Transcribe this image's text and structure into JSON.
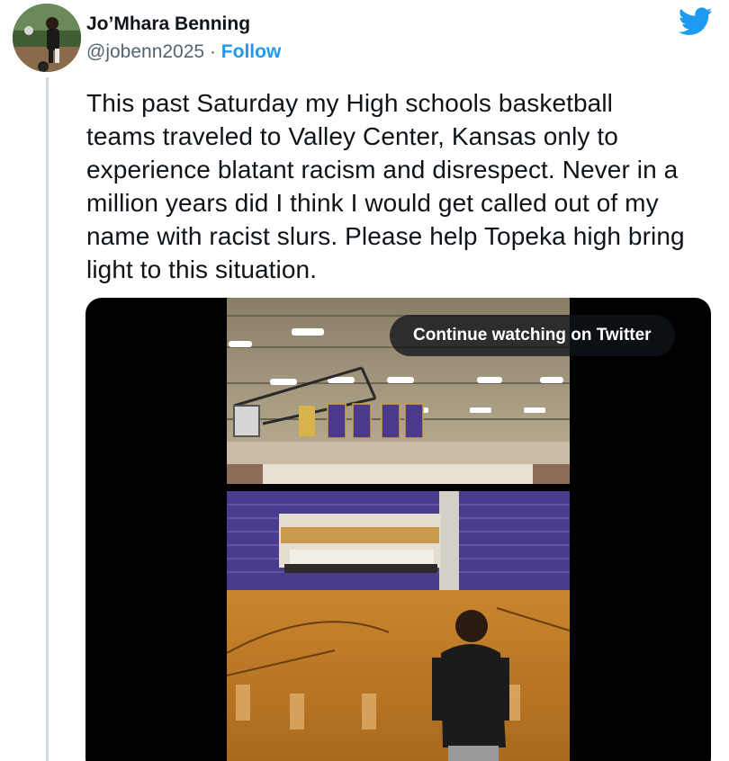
{
  "author": {
    "display_name": "Jo’Mhara Benning",
    "handle": "@jobenn2025",
    "separator": "·",
    "follow_label": "Follow"
  },
  "tweet": {
    "text": "This past Saturday my High schools basketball\nteams traveled to Valley Center, Kansas only to\nexperience blatant racism and disrespect. Never in a\nmillion years did I think I would get called out of my\nname with racist slurs. Please help Topeka high bring\nlight to this situation."
  },
  "media": {
    "type": "video",
    "overlay_label": "Continue watching on Twitter"
  },
  "icons": {
    "brand": "twitter-bird-icon",
    "brand_color": "#1d9bf0"
  },
  "colors": {
    "text": "#0f1419",
    "secondary_text": "#536471",
    "accent": "#1d9bf0",
    "thread_line": "#cfd9de"
  }
}
